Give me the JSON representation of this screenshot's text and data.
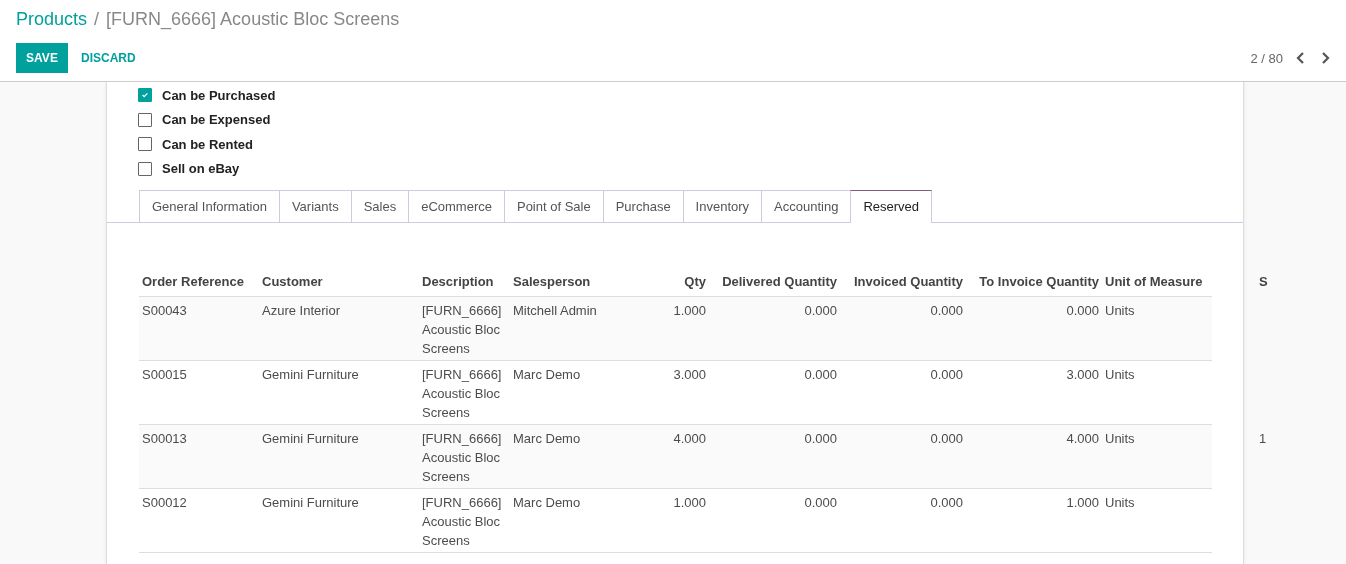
{
  "breadcrumb": {
    "parent": "Products",
    "separator": "/",
    "current": "[FURN_6666] Acoustic Bloc Screens"
  },
  "buttons": {
    "save": "SAVE",
    "discard": "DISCARD"
  },
  "pager": {
    "text": "2 / 80"
  },
  "options": [
    {
      "label": "Can be Purchased",
      "checked": true
    },
    {
      "label": "Can be Expensed",
      "checked": false
    },
    {
      "label": "Can be Rented",
      "checked": false
    },
    {
      "label": "Sell on eBay",
      "checked": false
    }
  ],
  "tabs": [
    {
      "label": "General Information",
      "selected": false
    },
    {
      "label": "Variants",
      "selected": false
    },
    {
      "label": "Sales",
      "selected": false
    },
    {
      "label": "eCommerce",
      "selected": false
    },
    {
      "label": "Point of Sale",
      "selected": false
    },
    {
      "label": "Purchase",
      "selected": false
    },
    {
      "label": "Inventory",
      "selected": false
    },
    {
      "label": "Accounting",
      "selected": false
    },
    {
      "label": "Reserved",
      "selected": true
    }
  ],
  "table": {
    "columns": [
      "Order Reference",
      "Customer",
      "Description",
      "Salesperson",
      "Qty",
      "Delivered Quantity",
      "Invoiced Quantity",
      "To Invoice Quantity",
      "Unit of Measure",
      "S"
    ],
    "rows": [
      {
        "cells": [
          "S00043",
          "Azure Interior",
          "[FURN_6666] Acoustic Bloc Screens",
          "Mitchell Admin",
          "1.000",
          "0.000",
          "0.000",
          "0.000",
          "Units",
          ""
        ]
      },
      {
        "cells": [
          "S00015",
          "Gemini Furniture",
          "[FURN_6666] Acoustic Bloc Screens",
          "Marc Demo",
          "3.000",
          "0.000",
          "0.000",
          "3.000",
          "Units",
          ""
        ]
      },
      {
        "cells": [
          "S00013",
          "Gemini Furniture",
          "[FURN_6666] Acoustic Bloc Screens",
          "Marc Demo",
          "4.000",
          "0.000",
          "0.000",
          "4.000",
          "Units",
          "1"
        ]
      },
      {
        "cells": [
          "S00012",
          "Gemini Furniture",
          "[FURN_6666] Acoustic Bloc Screens",
          "Marc Demo",
          "1.000",
          "0.000",
          "0.000",
          "1.000",
          "Units",
          ""
        ]
      }
    ]
  }
}
